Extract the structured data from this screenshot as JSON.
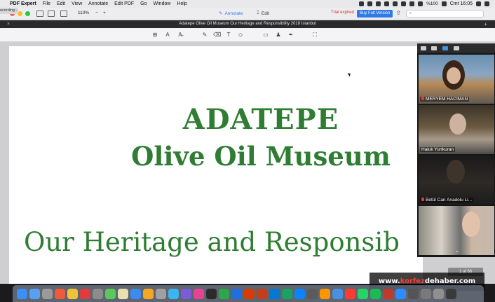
{
  "menubar": {
    "app_name": "PDF Expert",
    "items": [
      "File",
      "Edit",
      "View",
      "Annotate",
      "Edit PDF",
      "Go",
      "Window",
      "Help"
    ],
    "battery": "%100",
    "clock": "Cmt 16:05"
  },
  "recording_label": "ecording...",
  "toolbar": {
    "zoom_level": "110%",
    "zoom_minus": "−",
    "zoom_plus": "+",
    "annotate_label": "Annotate",
    "edit_label": "Edit",
    "trial_text": "Trial expired",
    "buy_label": "Buy Full Version"
  },
  "document": {
    "title": "Adatepe Olive Oil Museum Our  Heritage and Responsibility 2018 Istanbul",
    "heading_line1": "ADATEPE",
    "heading_line2": "Olive Oil Museum",
    "subheading": "Our  Heritage and Responsib",
    "page_indicator": "1 of 66"
  },
  "zoom_panel": {
    "participants": [
      {
        "name": "MERYEM HACIMAN"
      },
      {
        "name": "Haluk Yurtkuran"
      },
      {
        "name": "Betül Can Anadolu Li..."
      },
      {
        "name": ""
      }
    ],
    "collapse_glyph": "⌄"
  },
  "watermark": {
    "prefix": "www.",
    "brand_red": "korfez",
    "brand_rest": "dehaber",
    "suffix": ".com"
  },
  "dock": {
    "icon_colors": [
      "#3e8ef7",
      "#5aa0f0",
      "#9a9a9a",
      "#f05a3c",
      "#f0c23c",
      "#e03c3c",
      "#8c8c8c",
      "#5ac85a",
      "#e8e0b0",
      "#3c8cf0",
      "#f5a623",
      "#a0a0a0",
      "#3cb4f0",
      "#7b5cd8",
      "#e84393",
      "#2b2b2b",
      "#2ba84a",
      "#1f6fe0",
      "#d83b01",
      "#c43e1c",
      "#0078d4",
      "#1aa260",
      "#0a84ff",
      "#5b5b5b",
      "#ff9500",
      "#4a90e2",
      "#ff3b30",
      "#25d366",
      "#1db954",
      "#c0392b",
      "#2d8cff",
      "#555555",
      "#7a7a7a",
      "#909090",
      "#3a3a3a"
    ]
  }
}
